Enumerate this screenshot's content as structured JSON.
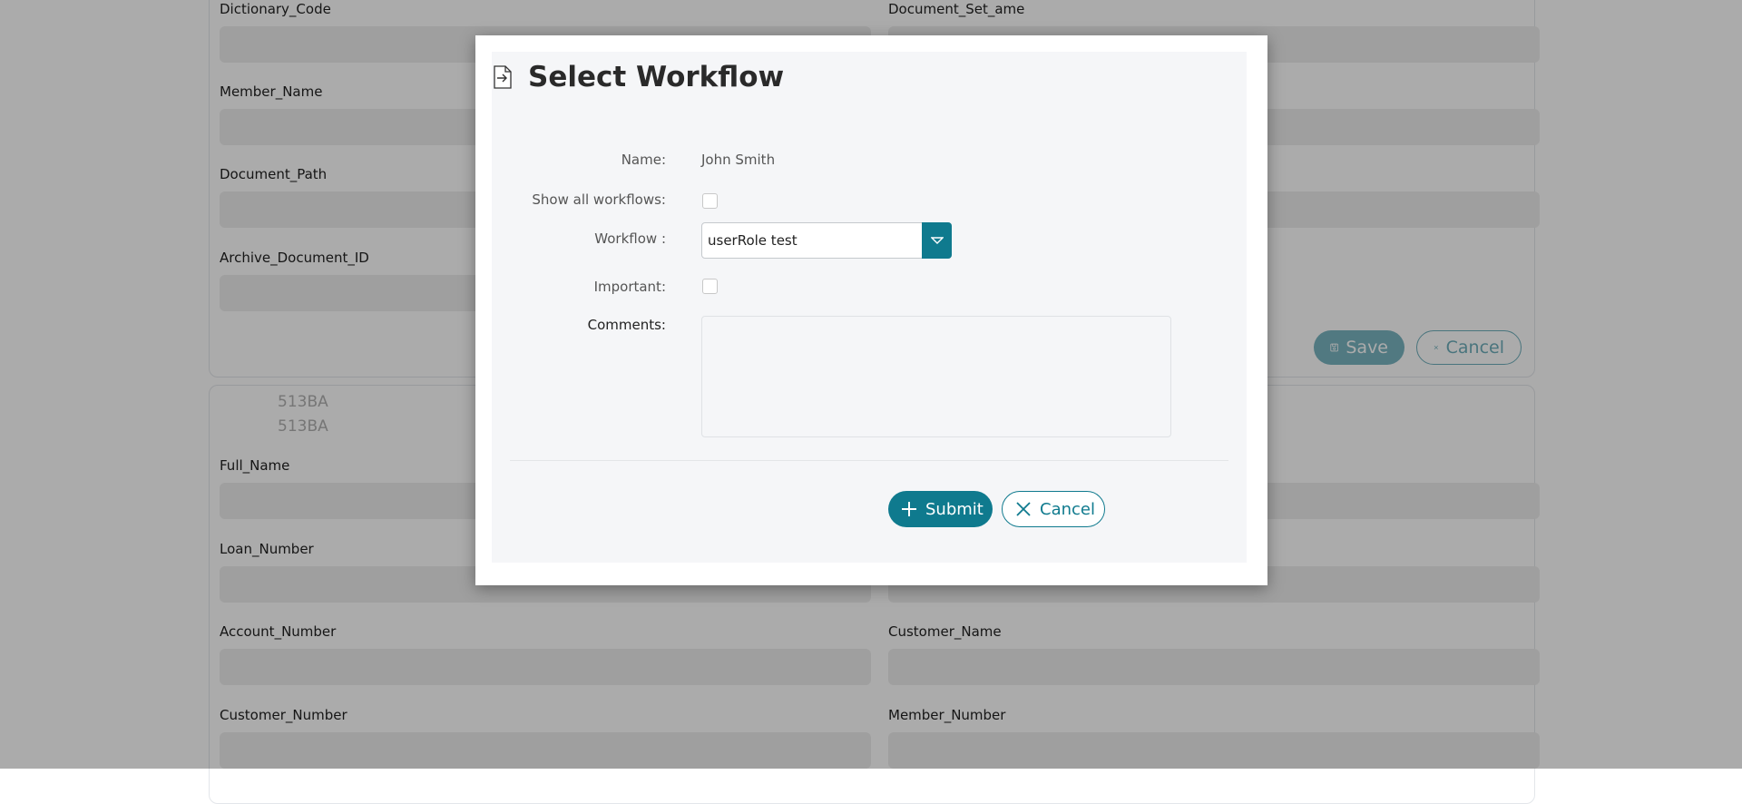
{
  "background_form": {
    "fields_left_top": [
      "Dictionary_Code",
      "Member_Name",
      "Document_Path",
      "Archive_Document_ID"
    ],
    "fields_right_top": [
      "Document_Set_ame"
    ],
    "save_label": "Save",
    "cancel_label": "Cancel",
    "ref_lines": [
      "513BA",
      "513BA"
    ],
    "fields_left_bottom": [
      "Full_Name",
      "Loan_Number",
      "Account_Number",
      "Customer_Number"
    ],
    "fields_right_bottom": [
      "Customer_Name",
      "Member_Number"
    ]
  },
  "modal": {
    "title": "Select Workflow",
    "name_label": "Name:",
    "name_value": "John Smith",
    "show_all_label": "Show all workflows:",
    "workflow_label": "Workflow :",
    "workflow_value": "userRole test",
    "important_label": "Important:",
    "comments_label": "Comments:",
    "comments_value": "",
    "submit_label": "Submit",
    "cancel_label": "Cancel"
  },
  "colors": {
    "accent": "#0f7a8e",
    "overlay": "rgba(0,0,0,0.33)"
  },
  "icons": {
    "title": "document-arrow-icon",
    "submit": "plus-icon",
    "cancel": "close-icon",
    "save": "floppy-disk-icon",
    "dropdown": "chevron-down-icon"
  }
}
